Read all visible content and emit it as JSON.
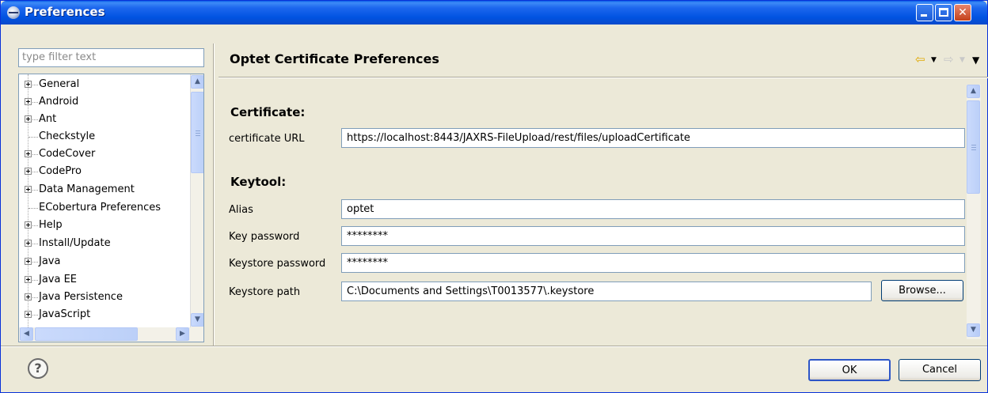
{
  "window": {
    "title": "Preferences"
  },
  "filter": {
    "placeholder": "type filter text"
  },
  "tree": {
    "items": [
      {
        "label": "General",
        "expandable": true
      },
      {
        "label": "Android",
        "expandable": true
      },
      {
        "label": "Ant",
        "expandable": true
      },
      {
        "label": "Checkstyle",
        "expandable": false
      },
      {
        "label": "CodeCover",
        "expandable": true
      },
      {
        "label": "CodePro",
        "expandable": true
      },
      {
        "label": "Data Management",
        "expandable": true
      },
      {
        "label": "ECobertura Preferences",
        "expandable": false
      },
      {
        "label": "Help",
        "expandable": true
      },
      {
        "label": "Install/Update",
        "expandable": true
      },
      {
        "label": "Java",
        "expandable": true
      },
      {
        "label": "Java EE",
        "expandable": true
      },
      {
        "label": "Java Persistence",
        "expandable": true
      },
      {
        "label": "JavaScript",
        "expandable": true
      }
    ]
  },
  "page": {
    "title": "Optet Certificate Preferences",
    "certificate_section": "Certificate:",
    "certificate_url_label": "certificate URL",
    "certificate_url_value": "https://localhost:8443/JAXRS-FileUpload/rest/files/uploadCertificate",
    "keytool_section": "Keytool:",
    "alias_label": "Alias",
    "alias_value": "optet",
    "key_password_label": "Key password",
    "key_password_value": "********",
    "keystore_password_label": "Keystore password",
    "keystore_password_value": "********",
    "keystore_path_label": "Keystore path",
    "keystore_path_value": "C:\\Documents and Settings\\T0013577\\.keystore",
    "browse_label": "Browse..."
  },
  "buttons": {
    "ok": "OK",
    "cancel": "Cancel",
    "help": "?"
  },
  "colors": {
    "titlebar": "#0053E1",
    "dialog_bg": "#ECE9D8",
    "field_border": "#7F9DB9",
    "nav_arrow": "#E0A800"
  },
  "icons": [
    "preferences-icon",
    "minimize-icon",
    "maximize-icon",
    "close-icon",
    "back-arrow-icon",
    "forward-arrow-icon",
    "view-menu-icon",
    "help-icon"
  ]
}
